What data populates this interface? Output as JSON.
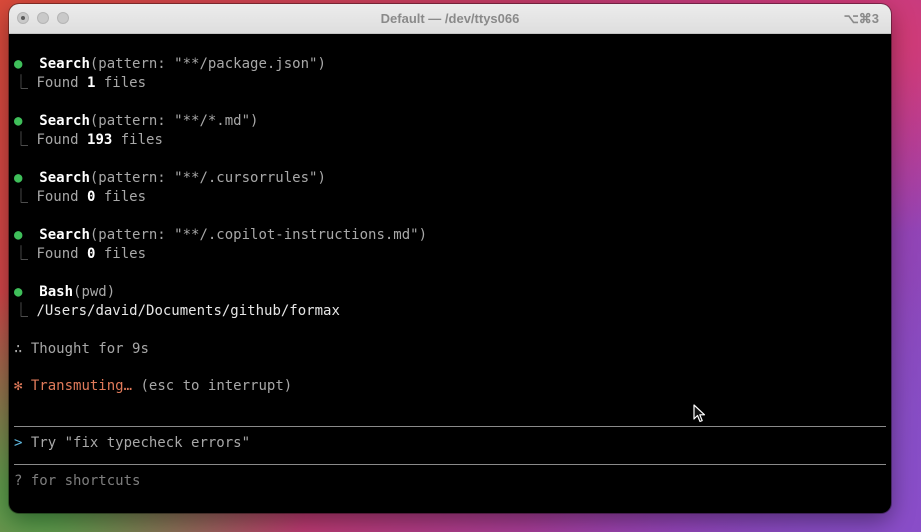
{
  "window": {
    "title": "Default — /dev/ttys066",
    "shortcut": "⌥⌘3"
  },
  "colors": {
    "success_dot": "#3fbf5a",
    "spinner": "#e07a5a",
    "prompt": "#5fb8e0",
    "background": "#000000"
  },
  "tool_calls": [
    {
      "bullet": "●",
      "tool": "Search",
      "args": "(pattern: \"**/package.json\")",
      "branch": "⎿",
      "result_prefix": "Found ",
      "result_count": "1",
      "result_suffix": " files"
    },
    {
      "bullet": "●",
      "tool": "Search",
      "args": "(pattern: \"**/*.md\")",
      "branch": "⎿",
      "result_prefix": "Found ",
      "result_count": "193",
      "result_suffix": " files"
    },
    {
      "bullet": "●",
      "tool": "Search",
      "args": "(pattern: \"**/.cursorrules\")",
      "branch": "⎿",
      "result_prefix": "Found ",
      "result_count": "0",
      "result_suffix": " files"
    },
    {
      "bullet": "●",
      "tool": "Search",
      "args": "(pattern: \"**/.copilot-instructions.md\")",
      "branch": "⎿",
      "result_prefix": "Found ",
      "result_count": "0",
      "result_suffix": " files"
    },
    {
      "bullet": "●",
      "tool": "Bash",
      "args": "(pwd)",
      "branch": "⎿",
      "result_prefix": "/Users/david/Documents/github/formax",
      "result_count": "",
      "result_suffix": ""
    }
  ],
  "thought": {
    "symbol": "∴",
    "text": "Thought for 9s"
  },
  "status": {
    "spinner": "✻",
    "working": "Transmuting…",
    "hint": " (esc to interrupt)"
  },
  "input": {
    "prompt": ">",
    "placeholder": "Try \"fix typecheck errors\""
  },
  "footer": {
    "hint": "? for shortcuts"
  },
  "icons": {
    "cursor": "mouse-pointer-icon"
  }
}
